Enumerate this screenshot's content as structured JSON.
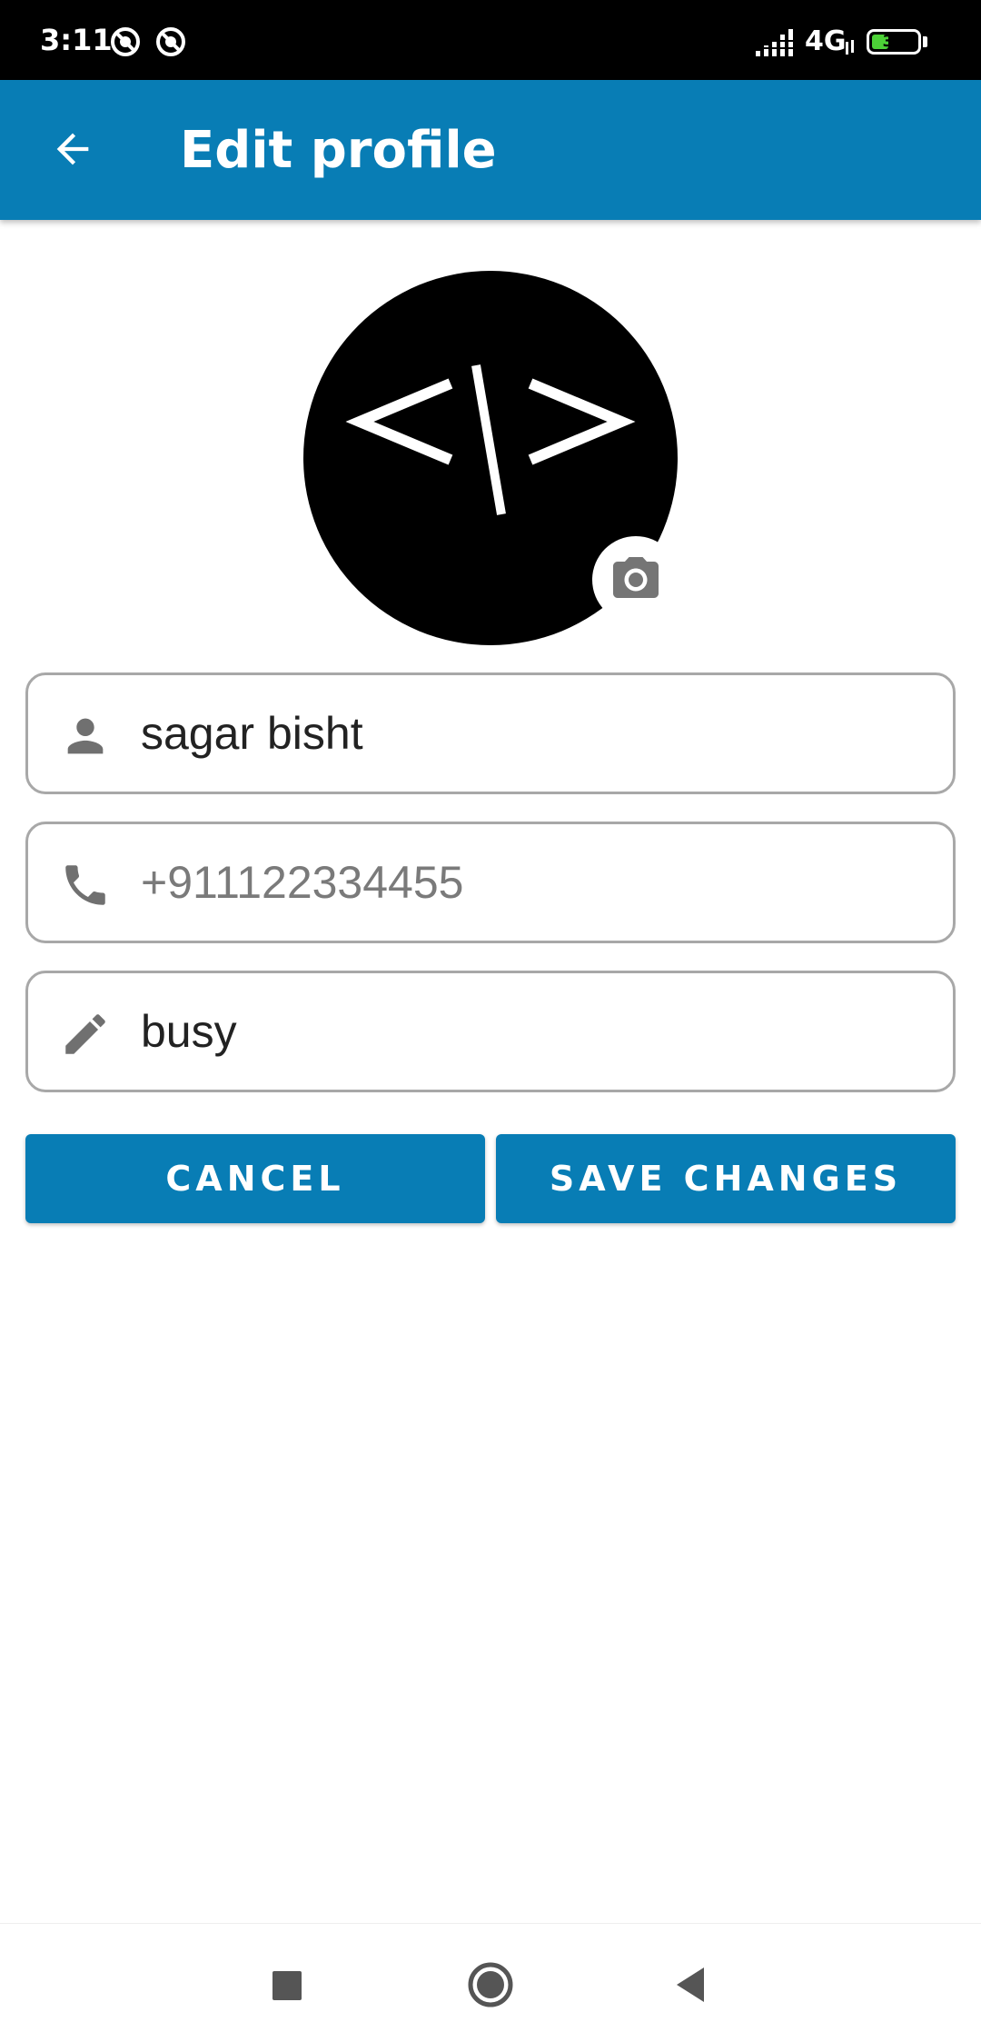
{
  "status_bar": {
    "time": "3:11",
    "network": "4G",
    "battery": "37",
    "battery_level": 0.37,
    "battery_color": "#4cd137",
    "icons": [
      "notification-blocked-icon",
      "notification-blocked-icon",
      "signal-icon",
      "battery-icon"
    ]
  },
  "app_bar": {
    "title": "Edit profile",
    "background": "#087db5",
    "back_icon": "arrow-back-icon"
  },
  "avatar": {
    "glyph": "</>",
    "background": "#000000",
    "camera_icon": "camera-icon"
  },
  "form": {
    "name": {
      "value": "sagar bisht",
      "placeholder": "",
      "icon": "person-icon"
    },
    "phone": {
      "value": "",
      "placeholder": "+911122334455",
      "icon": "phone-icon"
    },
    "status": {
      "value": "busy",
      "placeholder": "",
      "icon": "pencil-icon"
    }
  },
  "buttons": {
    "cancel_label": "CANCEL",
    "save_label": "SAVE CHANGES",
    "color": "#087db5"
  },
  "nav_bar": {
    "icons": [
      "recents-square-icon",
      "home-circle-icon",
      "back-triangle-icon"
    ]
  }
}
